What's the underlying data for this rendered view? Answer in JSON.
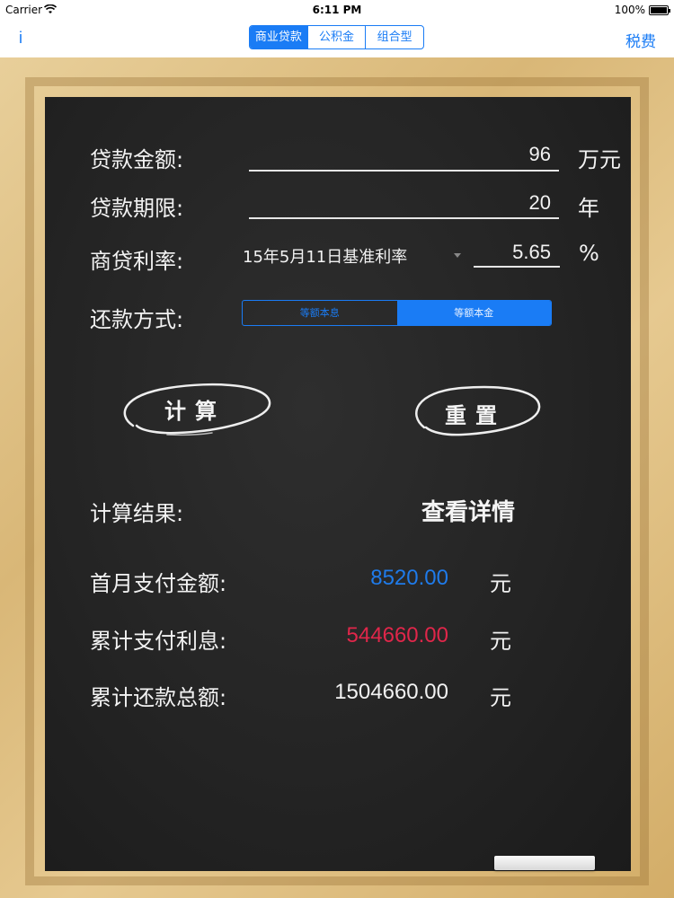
{
  "status_bar": {
    "carrier": "Carrier",
    "time": "6:11 PM",
    "battery": "100%"
  },
  "nav": {
    "info_label": "i",
    "tax_label": "税费",
    "segments": [
      "商业贷款",
      "公积金",
      "组合型"
    ],
    "selected_index": 0
  },
  "form": {
    "amount": {
      "label": "贷款金额:",
      "value": "96",
      "unit": "万元"
    },
    "term": {
      "label": "贷款期限:",
      "value": "20",
      "unit": "年"
    },
    "rate": {
      "label": "商贷利率:",
      "selected_option": "15年5月11日基准利率",
      "value": "5.65",
      "unit": "%"
    },
    "repayment": {
      "label": "还款方式:",
      "options": [
        "等额本息",
        "等额本金"
      ],
      "selected_index": 1
    }
  },
  "buttons": {
    "calculate": "计算",
    "reset": "重置"
  },
  "results": {
    "label": "计算结果:",
    "detail_link": "查看详情",
    "rows": [
      {
        "label": "首月支付金额:",
        "value": "8520.00",
        "unit": "元",
        "color": "#1f7bea"
      },
      {
        "label": "累计支付利息:",
        "value": "544660.00",
        "unit": "元",
        "color": "#e0264a"
      },
      {
        "label": "累计还款总额:",
        "value": "1504660.00",
        "unit": "元",
        "color": "#f2f2f2"
      }
    ]
  }
}
